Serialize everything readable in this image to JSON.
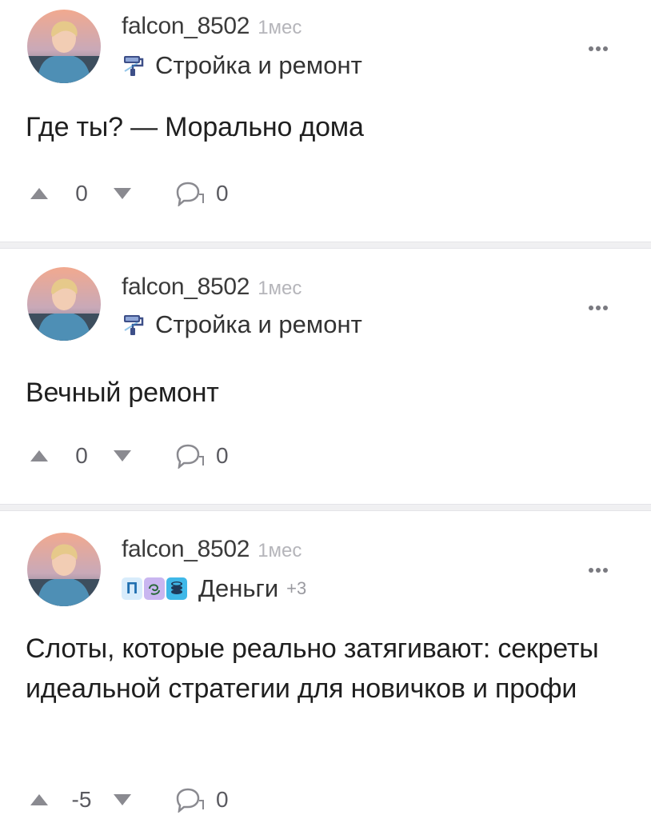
{
  "posts": [
    {
      "author": "falcon_8502",
      "time": "1мес",
      "community": "Стройка и ремонт",
      "text": "Где ты? — Морально дома",
      "rating": "0",
      "comments": "0"
    },
    {
      "author": "falcon_8502",
      "time": "1мес",
      "community": "Стройка и ремонт",
      "text": "Вечный ремонт",
      "rating": "0",
      "comments": "0"
    },
    {
      "author": "falcon_8502",
      "time": "1мес",
      "community": "Деньги",
      "extra_communities": "+3",
      "badge_letter": "П",
      "text": "Слоты, которые реально затягивают: секреты идеальной стратегии для новичков и профи",
      "rating": "-5",
      "comments": "0"
    }
  ],
  "colors": {
    "vote_arrow": "#8a8a90",
    "divider": "#f0f0f2",
    "timestamp": "#b5b5ba",
    "badge_blue": "#3a9ad9",
    "badge_purple": "#c9b6f0",
    "badge_cyan": "#3fb8e8"
  },
  "icons": {
    "avatar": "user-avatar",
    "community": "paint-roller-icon",
    "more": "more-dots-icon",
    "up": "arrow-up-icon",
    "down": "arrow-down-icon",
    "comment": "comment-bubble-icon"
  }
}
